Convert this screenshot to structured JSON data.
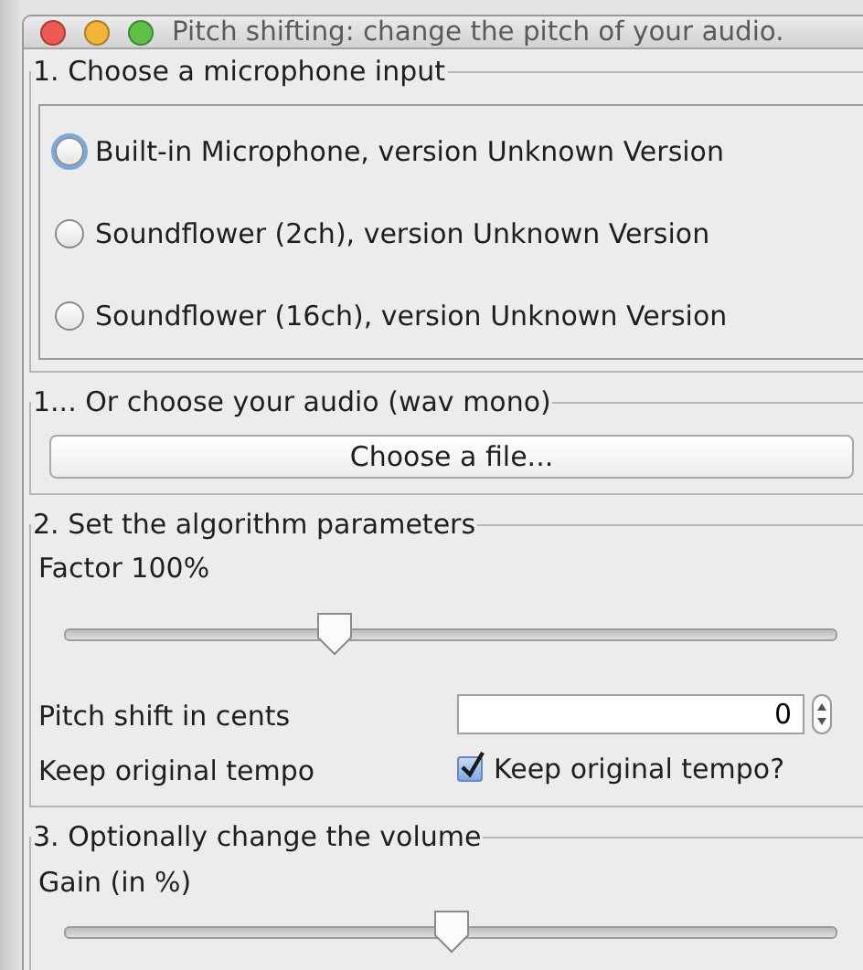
{
  "window": {
    "title": "Pitch shifting: change the pitch of your audio."
  },
  "microphone_section": {
    "title": "1. Choose a microphone input",
    "inputs": [
      {
        "label": "Built-in Microphone, version Unknown Version",
        "selected": false,
        "focused": true
      },
      {
        "label": "Soundflower (2ch), version Unknown Version",
        "selected": false,
        "focused": false
      },
      {
        "label": "Soundflower (16ch), version Unknown Version",
        "selected": false,
        "focused": false
      }
    ]
  },
  "file_section": {
    "title": "1... Or choose your audio (wav mono)",
    "button": "Choose a file..."
  },
  "parameters_section": {
    "title": "2. Set the algorithm parameters",
    "factor": {
      "label": "Factor 100%",
      "level": 0.35
    },
    "pitch_shift": {
      "label": "Pitch shift in cents",
      "value": "0"
    },
    "tempo": {
      "label": "Keep original tempo",
      "checkbox_label": "Keep original tempo?",
      "checked": true
    }
  },
  "volume_section": {
    "title": "3. Optionally change the volume",
    "gain": {
      "label": "Gain (in %)",
      "level": 0.5
    }
  }
}
